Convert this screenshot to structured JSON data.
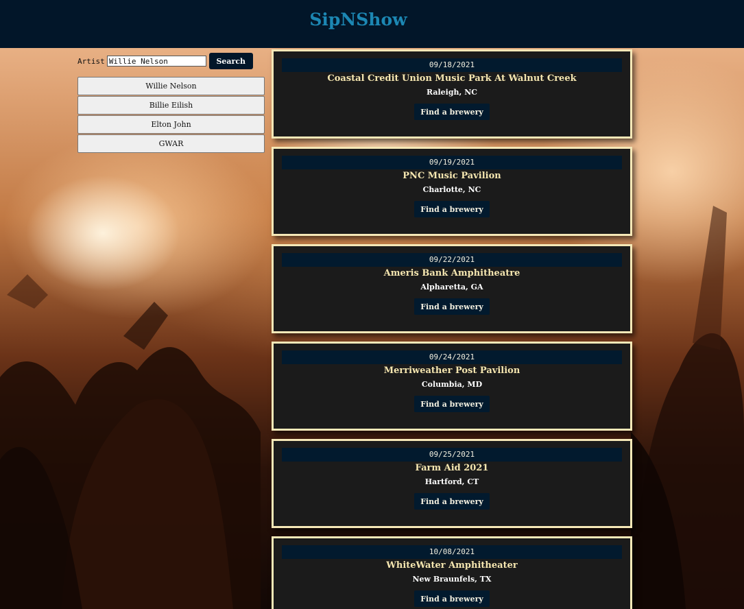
{
  "app": {
    "title": "SipNShow"
  },
  "search": {
    "label": "Artist",
    "value": "Willie Nelson",
    "button_label": "Search"
  },
  "history": [
    {
      "label": "Willie Nelson"
    },
    {
      "label": "Billie Eilish"
    },
    {
      "label": "Elton John"
    },
    {
      "label": "GWAR"
    }
  ],
  "events": [
    {
      "date": "09/18/2021",
      "venue": "Coastal Credit Union Music Park At Walnut Creek",
      "city": "Raleigh, NC",
      "button": "Find a brewery"
    },
    {
      "date": "09/19/2021",
      "venue": "PNC Music Pavilion",
      "city": "Charlotte, NC",
      "button": "Find a brewery"
    },
    {
      "date": "09/22/2021",
      "venue": "Ameris Bank Amphitheatre",
      "city": "Alpharetta, GA",
      "button": "Find a brewery"
    },
    {
      "date": "09/24/2021",
      "venue": "Merriweather Post Pavilion",
      "city": "Columbia, MD",
      "button": "Find a brewery"
    },
    {
      "date": "09/25/2021",
      "venue": "Farm Aid 2021",
      "city": "Hartford, CT",
      "button": "Find a brewery"
    },
    {
      "date": "10/08/2021",
      "venue": "WhiteWater Amphitheater",
      "city": "New Braunfels, TX",
      "button": "Find a brewery"
    }
  ],
  "colors": {
    "header_bg": "#021629",
    "logo": "#1c87b3",
    "card_border": "#f5e8b7",
    "card_bg": "#1b1b1b",
    "venue_text": "#f5e6b0",
    "button_bg": "#021a2e"
  }
}
